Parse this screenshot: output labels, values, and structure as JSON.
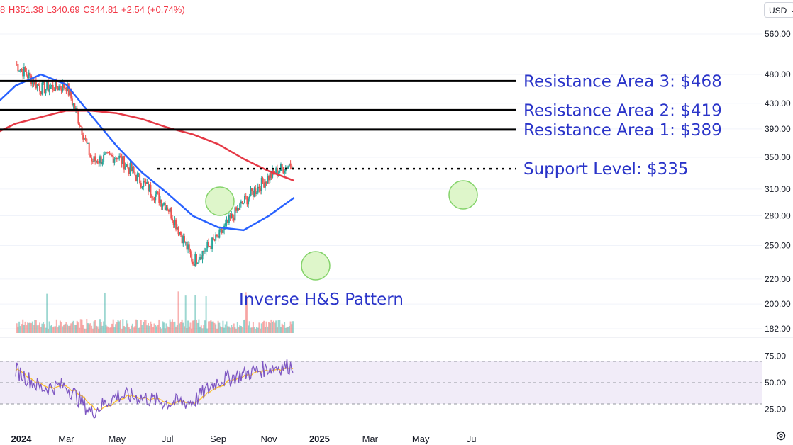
{
  "header": {
    "open_prefix": "8",
    "high": "H351.38",
    "low": "L340.69",
    "close": "C344.81",
    "change": "+2.54 (+0.74%)"
  },
  "currency_selector": {
    "value": "USD",
    "icon": "chevron-down-icon"
  },
  "settings_icon": "gear-icon",
  "colors": {
    "up": "#26a69a",
    "down": "#ef5350",
    "ma_blue": "#2962ff",
    "ma_red": "#e53946",
    "annotation": "#2a34c9",
    "rsi_line": "#7e57c2",
    "rsi_signal": "#fbc02d",
    "circle_fill": "#c8f0a6",
    "circle_stroke": "#84d36a"
  },
  "chart_data": [
    {
      "type": "candlestick",
      "title": "",
      "y_axis_ticks": [
        "560.00",
        "480.00",
        "430.00",
        "390.00",
        "350.00",
        "310.00",
        "280.00",
        "250.00",
        "220.00",
        "200.00",
        "182.00"
      ],
      "y_scale": "log",
      "x_axis_ticks": [
        "2024",
        "Mar",
        "May",
        "Jul",
        "Sep",
        "Nov",
        "2025",
        "Mar",
        "May",
        "Ju"
      ],
      "last_ohlc": {
        "high": 351.38,
        "low": 340.69,
        "close": 344.81,
        "change": 2.54,
        "change_pct": 0.74
      },
      "closes_by_month": [
        {
          "month": "2024-01",
          "close": 500
        },
        {
          "month": "2024-02",
          "close": 455
        },
        {
          "month": "2024-03",
          "close": 460
        },
        {
          "month": "2024-04",
          "close": 345
        },
        {
          "month": "2024-05",
          "close": 352
        },
        {
          "month": "2024-06",
          "close": 318
        },
        {
          "month": "2024-07",
          "close": 290
        },
        {
          "month": "2024-08",
          "close": 235
        },
        {
          "month": "2024-09",
          "close": 258
        },
        {
          "month": "2024-10",
          "close": 295
        },
        {
          "month": "2024-11",
          "close": 325
        },
        {
          "month": "2024-12",
          "close": 344.81
        }
      ],
      "moving_averages": [
        {
          "color": "blue",
          "points": [
            {
              "x": "2023-12",
              "y": 420
            },
            {
              "x": "2024-01",
              "y": 460
            },
            {
              "x": "2024-02",
              "y": 480
            },
            {
              "x": "2024-03",
              "y": 462
            },
            {
              "x": "2024-04",
              "y": 410
            },
            {
              "x": "2024-05",
              "y": 365
            },
            {
              "x": "2024-06",
              "y": 330
            },
            {
              "x": "2024-07",
              "y": 305
            },
            {
              "x": "2024-08",
              "y": 280
            },
            {
              "x": "2024-09",
              "y": 268
            },
            {
              "x": "2024-10",
              "y": 265
            },
            {
              "x": "2024-11",
              "y": 280
            },
            {
              "x": "2024-12",
              "y": 300
            }
          ]
        },
        {
          "color": "red",
          "points": [
            {
              "x": "2023-12",
              "y": 380
            },
            {
              "x": "2024-01",
              "y": 398
            },
            {
              "x": "2024-02",
              "y": 408
            },
            {
              "x": "2024-03",
              "y": 418
            },
            {
              "x": "2024-04",
              "y": 418
            },
            {
              "x": "2024-05",
              "y": 414
            },
            {
              "x": "2024-06",
              "y": 405
            },
            {
              "x": "2024-07",
              "y": 392
            },
            {
              "x": "2024-08",
              "y": 382
            },
            {
              "x": "2024-09",
              "y": 368
            },
            {
              "x": "2024-10",
              "y": 348
            },
            {
              "x": "2024-11",
              "y": 332
            },
            {
              "x": "2024-12",
              "y": 320
            }
          ]
        }
      ],
      "annotations": [
        {
          "text": "Resistance Area 3: $468",
          "level": 468,
          "style": "solid"
        },
        {
          "text": "Resistance Area 2: $419",
          "level": 419,
          "style": "solid"
        },
        {
          "text": "Resistance Area 1: $389",
          "level": 389,
          "style": "solid"
        },
        {
          "text": "Support Level: $335",
          "level": 335,
          "style": "dotted"
        },
        {
          "text": "Inverse H&S Pattern",
          "level": null,
          "style": "label"
        }
      ]
    },
    {
      "type": "line",
      "title": "",
      "y_axis_ticks": [
        "75.00",
        "50.00",
        "25.00"
      ],
      "ylim": [
        10,
        90
      ],
      "band": [
        30,
        70
      ],
      "series_monthly": [
        {
          "month": "2024-01",
          "value": 62
        },
        {
          "month": "2024-02",
          "value": 45
        },
        {
          "month": "2024-03",
          "value": 47
        },
        {
          "month": "2024-04",
          "value": 22
        },
        {
          "month": "2024-05",
          "value": 38
        },
        {
          "month": "2024-06",
          "value": 36
        },
        {
          "month": "2024-07",
          "value": 31
        },
        {
          "month": "2024-08",
          "value": 32
        },
        {
          "month": "2024-09",
          "value": 52
        },
        {
          "month": "2024-10",
          "value": 58
        },
        {
          "month": "2024-11",
          "value": 64
        },
        {
          "month": "2024-12",
          "value": 66
        }
      ]
    }
  ]
}
